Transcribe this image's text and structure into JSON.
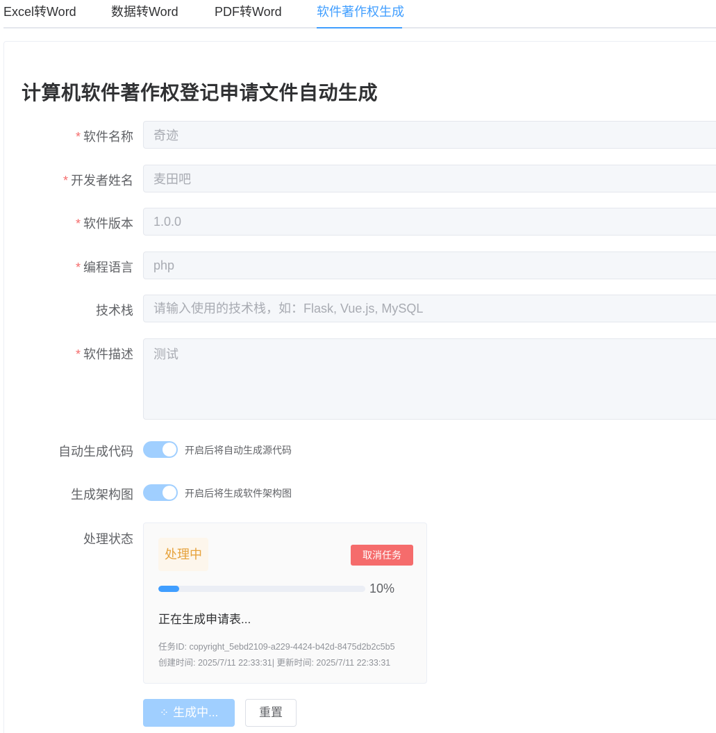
{
  "tabs": [
    {
      "label": "Excel转Word",
      "active": false
    },
    {
      "label": "数据转Word",
      "active": false
    },
    {
      "label": "PDF转Word",
      "active": false
    },
    {
      "label": "软件著作权生成",
      "active": true
    }
  ],
  "page": {
    "title": "计算机软件著作权登记申请文件自动生成"
  },
  "form": {
    "required_mark": "*",
    "software_name": {
      "label": "软件名称",
      "value": "奇迹"
    },
    "developer_name": {
      "label": "开发者姓名",
      "value": "麦田吧"
    },
    "version": {
      "label": "软件版本",
      "value": "1.0.0"
    },
    "language": {
      "label": "编程语言",
      "value": "php"
    },
    "tech_stack": {
      "label": "技术栈",
      "value": "",
      "placeholder": "请输入使用的技术栈，如：Flask, Vue.js, MySQL"
    },
    "description": {
      "label": "软件描述",
      "value": "测试"
    },
    "auto_code": {
      "label": "自动生成代码",
      "enabled": true,
      "hint": "开启后将自动生成源代码"
    },
    "architecture": {
      "label": "生成架构图",
      "enabled": true,
      "hint": "开启后将生成软件架构图"
    }
  },
  "status": {
    "label": "处理状态",
    "tag": "处理中",
    "cancel_label": "取消任务",
    "progress_percent": 10,
    "progress_text": "10%",
    "message": "正在生成申请表...",
    "task_id_line": "任务ID: copyright_5ebd2109-a229-4424-b42d-8475d2b2c5b5",
    "time_line": "创建时间: 2025/7/11 22:33:31| 更新时间: 2025/7/11 22:33:31"
  },
  "actions": {
    "generate_label": "生成中...",
    "reset_label": "重置"
  },
  "colors": {
    "primary": "#409eff",
    "primary_light": "#a0cfff",
    "danger": "#f56c6c",
    "warning": "#e6a23c"
  }
}
